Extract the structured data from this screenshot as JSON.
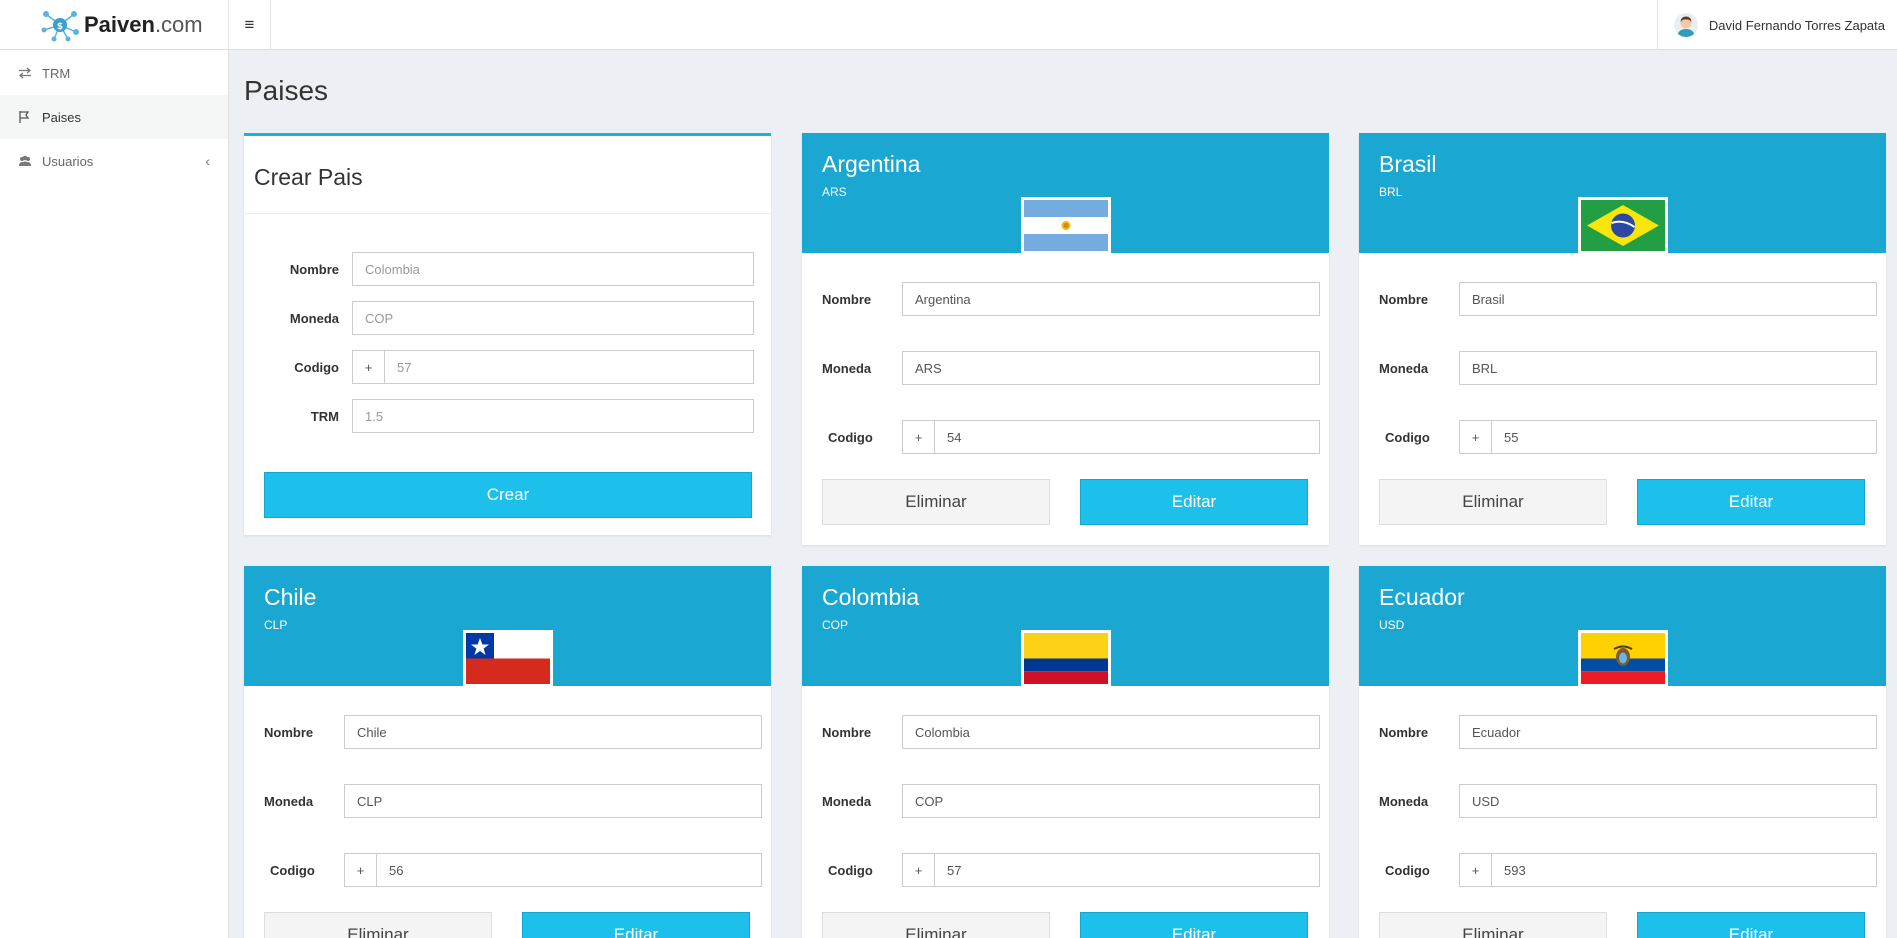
{
  "brand": {
    "name": "Paiven",
    "domain": ".com"
  },
  "header": {
    "user_name": "David Fernando Torres Zapata",
    "menu_icon": "hamburger-icon"
  },
  "sidebar": {
    "items": [
      {
        "label": "TRM",
        "icon": "exchange-icon"
      },
      {
        "label": "Paises",
        "icon": "flag-icon"
      },
      {
        "label": "Usuarios",
        "icon": "users-icon"
      }
    ]
  },
  "page": {
    "title": "Paises"
  },
  "create_form": {
    "title": "Crear Pais",
    "nombre_label": "Nombre",
    "nombre_placeholder": "Colombia",
    "moneda_label": "Moneda",
    "moneda_placeholder": "COP",
    "codigo_label": "Codigo",
    "codigo_prefix": "+",
    "codigo_placeholder": "57",
    "trm_label": "TRM",
    "trm_placeholder": "1.5",
    "submit_label": "Crear"
  },
  "labels": {
    "nombre": "Nombre",
    "moneda": "Moneda",
    "codigo": "Codigo",
    "prefix": "+",
    "delete": "Eliminar",
    "edit": "Editar"
  },
  "countries": [
    {
      "name": "Argentina",
      "currency": "ARS",
      "code": "54",
      "flag": "argentina-flag"
    },
    {
      "name": "Brasil",
      "currency": "BRL",
      "code": "55",
      "flag": "brazil-flag"
    },
    {
      "name": "Chile",
      "currency": "CLP",
      "code": "56",
      "flag": "chile-flag"
    },
    {
      "name": "Colombia",
      "currency": "COP",
      "code": "57",
      "flag": "colombia-flag"
    },
    {
      "name": "Ecuador",
      "currency": "USD",
      "code": "593",
      "flag": "ecuador-flag"
    }
  ],
  "colors": {
    "accent": "#1dbfeb",
    "card_header": "#1aa7d2",
    "background": "#ecf0f5"
  }
}
